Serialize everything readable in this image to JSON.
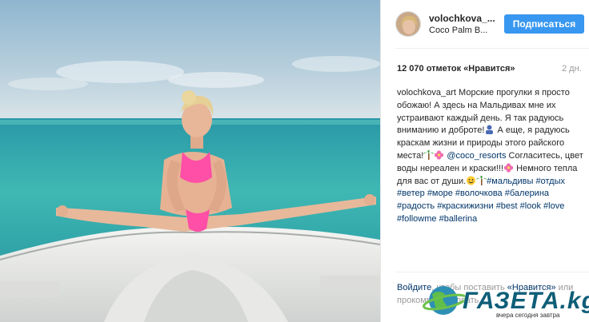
{
  "post": {
    "username": "volochkova_...",
    "location": "Coco Palm B...",
    "follow_label": "Подписаться",
    "likes": "12 070 отметок «Нравится»",
    "time": "2 дн.",
    "caption": {
      "author": "volochkova_art",
      "l1": " Морские прогулки я просто обожаю! А здесь на Мальдивах мне их устраивают каждый день. Я так радуюсь вниманию и доброте!",
      "l2": " А еще, я радуюсь краскам жизни и природы этого райского места!",
      "mention": "@coco_resorts",
      "l3": " Согласитесь, цвет воды нереален и краски!!!",
      "l4": " Немного тепла для вас от души.",
      "tags": [
        "#мальдивы",
        "#отдых",
        "#ветер",
        "#море",
        "#волочкова",
        "#балерина",
        "#радость",
        "#краскижизни",
        "#best",
        "#look",
        "#love",
        "#followme",
        "#ballerina"
      ]
    },
    "login": {
      "prefix": "Войдите",
      "middle": ", чтобы поставить",
      "link2": "«Нравится»",
      "suffix": " или прокомментировать."
    }
  },
  "watermark": {
    "text": "ГАЗЕТА.kg",
    "sub": "вчера сегодня завтра"
  },
  "colors": {
    "follow": "#3897f0",
    "hashtag": "#003569",
    "sea": "#3fb5b4",
    "sky": "#9ec4d8"
  },
  "icons": [
    "palm-emoji",
    "flower-emoji",
    "smile-emoji"
  ]
}
